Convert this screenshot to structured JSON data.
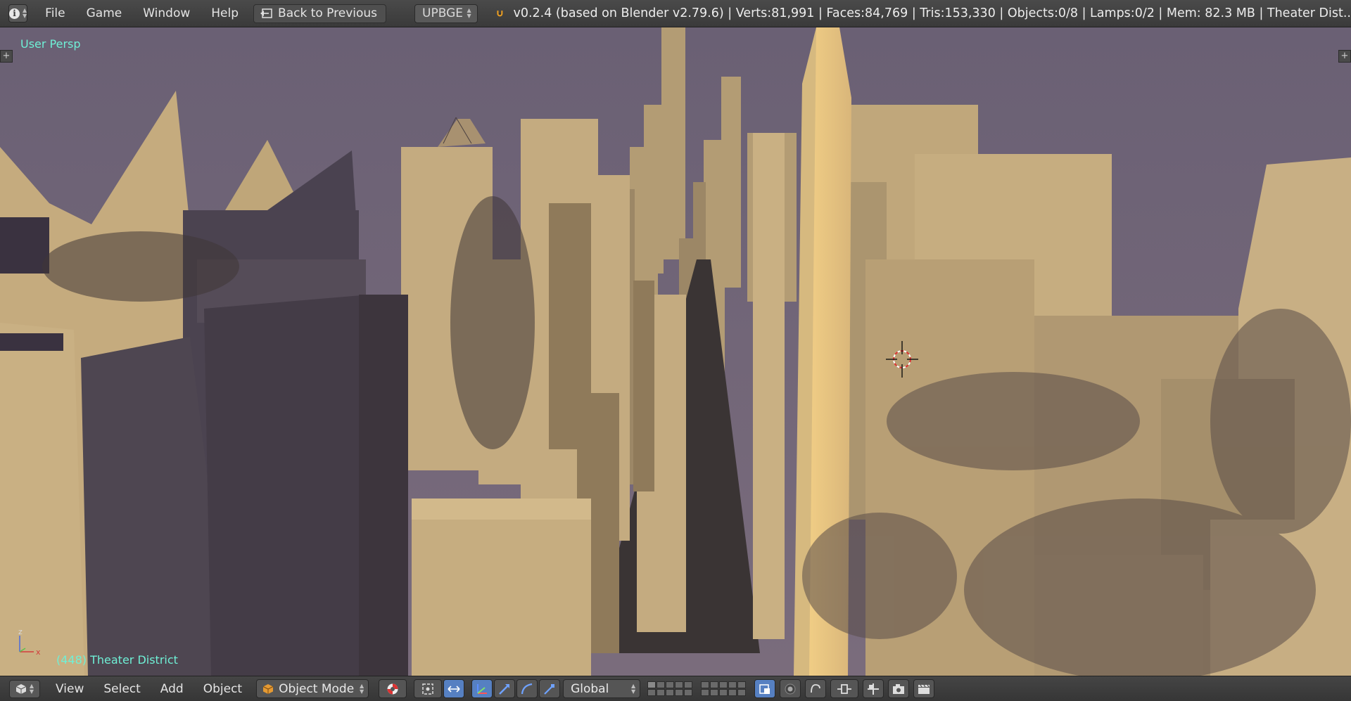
{
  "topbar": {
    "menu": [
      "File",
      "Game",
      "Window",
      "Help"
    ],
    "back_button": "Back to Previous",
    "render_engine": "UPBGE",
    "stats": "v0.2.4 (based on Blender v2.79.6)  | Verts:81,991 | Faces:84,769 | Tris:153,330 | Objects:0/8 | Lamps:0/2 | Mem: 82.3 MB | Theater Dist.."
  },
  "viewport": {
    "view_label": "User Persp",
    "scene_label": "(448) Theater District",
    "axis_labels": {
      "x": "x",
      "z": "z"
    },
    "colors": {
      "sky": "#6e6376",
      "building_light": "#c9b083",
      "building_shadow": "#4d4550"
    }
  },
  "bottombar": {
    "menu": [
      "View",
      "Select",
      "Add",
      "Object"
    ],
    "mode": "Object Mode",
    "orientation": "Global"
  }
}
